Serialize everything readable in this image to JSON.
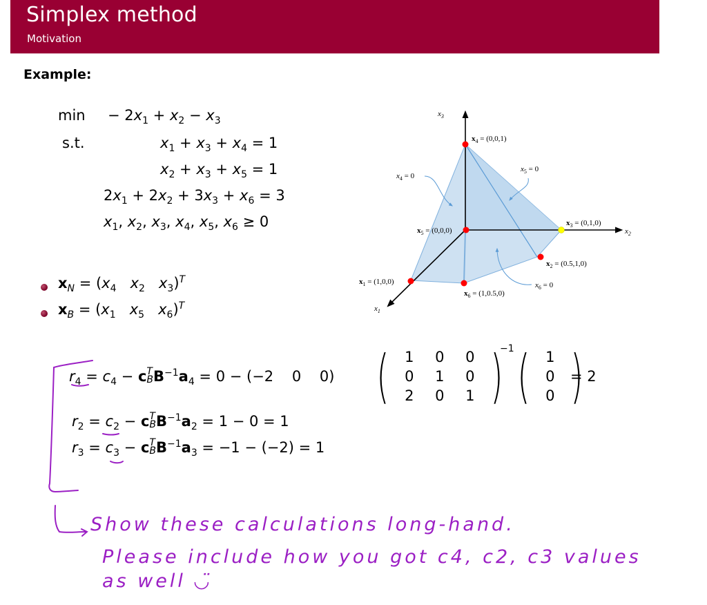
{
  "header": {
    "title": "Simplex method",
    "subtitle": "Motivation"
  },
  "example_label": "Example:",
  "lp": {
    "objective_keyword": "min",
    "constraint_keyword": "s.t.",
    "objective": "−2x1 + x2 − x3",
    "constraints": [
      "x1 + x3 + x4 = 1",
      "x2 + x3 + x5 = 1",
      "2x1 + 2x2 + 3x3 + x6 = 3",
      "x1, x2, x3, x4, x5, x6 ≥ 0"
    ]
  },
  "bullets": [
    {
      "lhs": "x_N",
      "entries": [
        "x4",
        "x2",
        "x3"
      ]
    },
    {
      "lhs": "x_B",
      "entries": [
        "x1",
        "x5",
        "x6"
      ]
    }
  ],
  "calculations": {
    "r4": {
      "lhs": "r4 = c4 − c_B^T B^−1 a4 = 0 − (−2  0  0)",
      "cB_row": [
        "−2",
        "0",
        "0"
      ],
      "B_matrix": [
        [
          "1",
          "0",
          "0"
        ],
        [
          "0",
          "1",
          "0"
        ],
        [
          "2",
          "0",
          "1"
        ]
      ],
      "inverse_exp": "−1",
      "a4": [
        "1",
        "0",
        "0"
      ],
      "result": "= 2"
    },
    "r2": "r2 = c2 − c_B^T B^−1 a2 = 1 − 0 = 1",
    "r3": "r3 = c3 − c_B^T B^−1 a3 = −1 − (−2) = 1"
  },
  "diagram": {
    "axes": [
      "x1",
      "x2",
      "x3"
    ],
    "vertices": [
      {
        "label": "x4 = (0,0,1)",
        "color": "#ff0000"
      },
      {
        "label": "x5 = (0,0,0)",
        "color": "#ff0000"
      },
      {
        "label": "x3 = (0,1,0)",
        "color": "#ffff00"
      },
      {
        "label": "x2 = (0.5,1,0)",
        "color": "#ff0000"
      },
      {
        "label": "x1 = (1,0,0)",
        "color": "#ff0000"
      },
      {
        "label": "x6 = (1,0.5,0)",
        "color": "#ff0000"
      }
    ],
    "faces": [
      "x4 = 0",
      "x5 = 0",
      "x6 = 0"
    ]
  },
  "annotation": {
    "lines": [
      "Show these calculations long-hand.",
      "Please include how you got c4, c2, c3 values",
      "as well ◡̈"
    ],
    "color": "#9b1fc4"
  },
  "colors": {
    "header_bg": "#990033",
    "bullet": "#8a0a34",
    "polytope_fill": "#c6dcf0",
    "polytope_edge": "#5b9bd5"
  }
}
